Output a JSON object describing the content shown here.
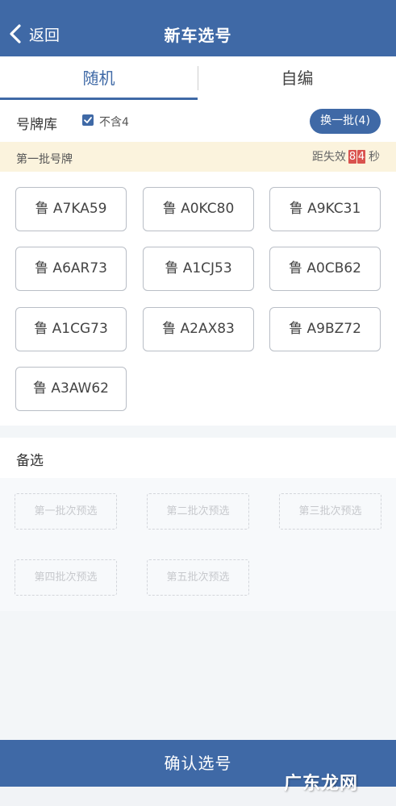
{
  "header": {
    "back_label": "返回",
    "title": "新车选号",
    "color": "#3f69a6"
  },
  "tabs": [
    {
      "label": "随机",
      "active": true
    },
    {
      "label": "自编",
      "active": false
    }
  ],
  "library": {
    "label": "号牌库",
    "exclude_four": {
      "label": "不含4",
      "checked": true
    },
    "refresh_label": "换一批(4)"
  },
  "batch": {
    "label": "第一批号牌",
    "countdown_prefix": "距失效",
    "countdown_digits": [
      "8",
      "4"
    ],
    "countdown_unit": "秒",
    "bar_color": "#fbf3dd",
    "digit_color": "#d9534f"
  },
  "plates": [
    "鲁 A7KA59",
    "鲁 A0KC80",
    "鲁 A9KC31",
    "鲁 A6AR73",
    "鲁 A1CJ53",
    "鲁 A0CB62",
    "鲁 A1CG73",
    "鲁 A2AX83",
    "鲁 A9BZ72",
    "鲁 A3AW62"
  ],
  "alternatives": {
    "title": "备选",
    "slots": [
      "第一批次预选",
      "第二批次预选",
      "第三批次预选",
      "第四批次预选",
      "第五批次预选"
    ]
  },
  "confirm_label": "确认选号",
  "watermark": "广东龙网"
}
